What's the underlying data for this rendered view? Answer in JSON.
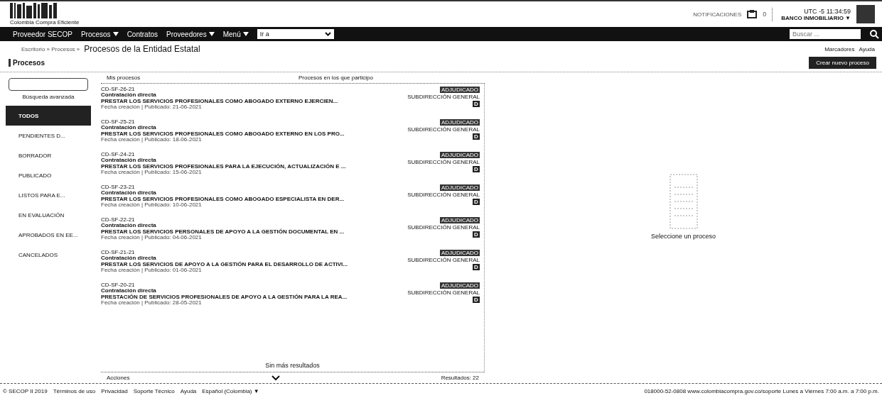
{
  "logo": {
    "subtitle": "Colombia Compra Eficiente"
  },
  "header": {
    "notice": "NOTIFICACIONES",
    "counter": "0",
    "time": "UTC -5 11:34:59",
    "user": "BANCO INMOBILIARIO ▼"
  },
  "nav": {
    "items": [
      {
        "label": "Proveedor SECOP",
        "caret": false
      },
      {
        "label": "Procesos",
        "caret": true
      },
      {
        "label": "Contratos",
        "caret": false
      },
      {
        "label": "Proveedores",
        "caret": true
      },
      {
        "label": "Menú",
        "caret": true
      }
    ],
    "goto": "Ir a",
    "search_placeholder": "Buscar ..."
  },
  "breadcrumb": {
    "trail": "Escritorio » Procesos »",
    "current": "Procesos de la Entidad Estatal",
    "links": [
      "Marcadores",
      "Ayuda"
    ]
  },
  "section_title": "Procesos",
  "create_button": "Crear nuevo proceso",
  "sidebar": {
    "advanced": "Búsqueda avanzada",
    "items": [
      {
        "label": "TODOS",
        "selected": true
      },
      {
        "label": "PENDIENTES D...",
        "selected": false
      },
      {
        "label": "BORRADOR",
        "selected": false
      },
      {
        "label": "PUBLICADO",
        "selected": false
      },
      {
        "label": "LISTOS PARA E...",
        "selected": false
      },
      {
        "label": "EN EVALUACIÓN",
        "selected": false
      },
      {
        "label": "APROBADOS EN EE...",
        "selected": false
      },
      {
        "label": "CANCELADOS",
        "selected": false
      }
    ]
  },
  "filters": [
    "Mis procesos",
    "Procesos en los que participo"
  ],
  "processes": [
    {
      "ref": "CD-SF-26-21",
      "type": "Contratación directa",
      "title": "PRESTAR LOS SERVICIOS PROFESIONALES COMO ABOGADO EXTERNO EJERCIEN...",
      "dates": "Fecha creación | Publicado: 21-06-2021",
      "status": "ADJUDICADO",
      "unit": "SUBDIRECCIÓN GENERAL",
      "letter": "D"
    },
    {
      "ref": "CD-SF-25-21",
      "type": "Contratación directa",
      "title": "PRESTAR LOS SERVICIOS PROFESIONALES COMO ABOGADO EXTERNO EN LOS PRO...",
      "dates": "Fecha creación | Publicado: 18-06-2021",
      "status": "ADJUDICADO",
      "unit": "SUBDIRECCIÓN GENERAL",
      "letter": "D"
    },
    {
      "ref": "CD-SF-24-21",
      "type": "Contratación directa",
      "title": "PRESTAR LOS SERVICIOS PROFESIONALES PARA LA EJECUCIÓN, ACTUALIZACIÓN E ...",
      "dates": "Fecha creación | Publicado: 15-06-2021",
      "status": "ADJUDICADO",
      "unit": "SUBDIRECCIÓN GENERAL",
      "letter": "D"
    },
    {
      "ref": "CD-SF-23-21",
      "type": "Contratación directa",
      "title": "PRESTAR LOS SERVICIOS PROFESIONALES COMO ABOGADO ESPECIALISTA EN DER...",
      "dates": "Fecha creación | Publicado: 10-06-2021",
      "status": "ADJUDICADO",
      "unit": "SUBDIRECCIÓN GENERAL",
      "letter": "D"
    },
    {
      "ref": "CD-SF-22-21",
      "type": "Contratación directa",
      "title": "PRESTAR LOS SERVICIOS PERSONALES DE APOYO A LA GESTIÓN DOCUMENTAL EN ...",
      "dates": "Fecha creación | Publicado: 04-06-2021",
      "status": "ADJUDICADO",
      "unit": "SUBDIRECCIÓN GENERAL",
      "letter": "D"
    },
    {
      "ref": "CD-SF-21-21",
      "type": "Contratación directa",
      "title": "PRESTAR LOS SERVICIOS DE APOYO A LA GESTIÓN PARA EL DESARROLLO DE ACTIVI...",
      "dates": "Fecha creación | Publicado: 01-06-2021",
      "status": "ADJUDICADO",
      "unit": "SUBDIRECCIÓN GENERAL",
      "letter": "D"
    },
    {
      "ref": "CD-SF-20-21",
      "type": "Contratación directa",
      "title": "PRESTACIÓN DE SERVICIOS PROFESIONALES DE APOYO A LA GESTIÓN PARA LA REA...",
      "dates": "Fecha creación | Publicado: 28-05-2021",
      "status": "ADJUDICADO",
      "unit": "SUBDIRECCIÓN GENERAL",
      "letter": "D"
    }
  ],
  "no_more": "Sin más resultados",
  "actions": "Acciones",
  "results": "Resultados: 22",
  "empty_detail": "Seleccione un proceso",
  "footer": {
    "links": [
      "© SECOP II 2019",
      "Términos de uso",
      "Privacidad",
      "Soporte Técnico",
      "Ayuda",
      "Español (Colombia) ▼"
    ],
    "contact": "018000-52-0808 www.colombiacompra.gov.co/soporte  Lunes a Viernes 7:00 a.m. a 7:00 p.m."
  }
}
